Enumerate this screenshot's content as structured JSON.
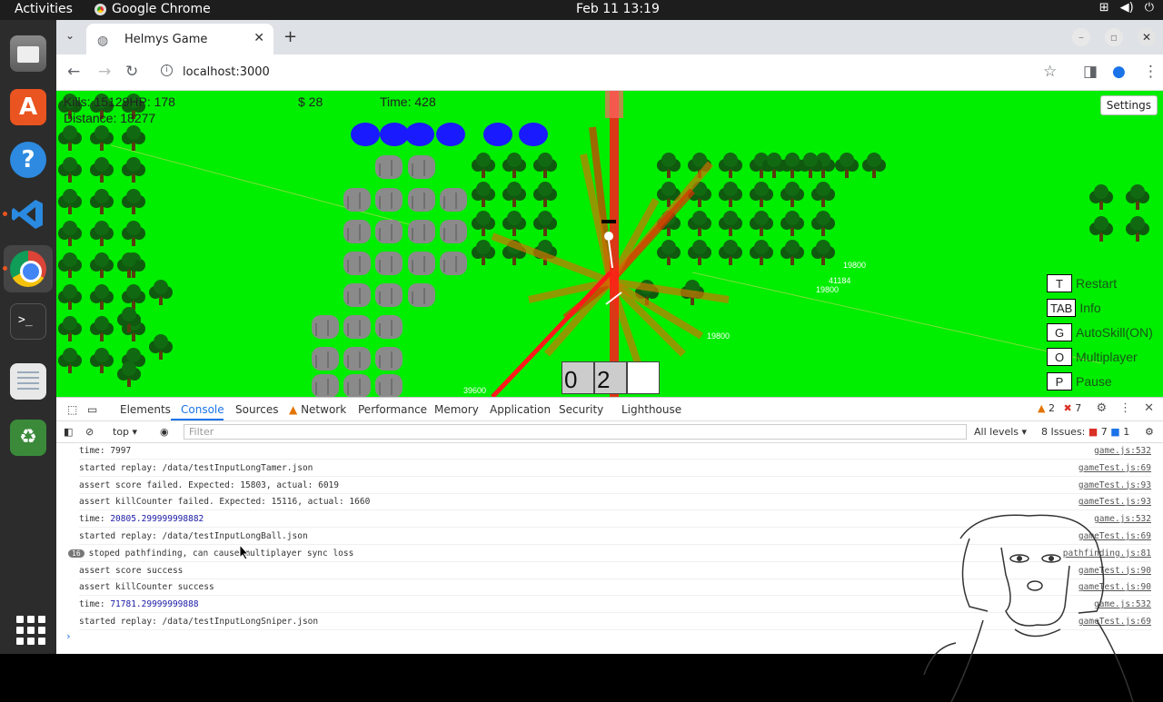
{
  "topbar": {
    "activities": "Activities",
    "app_name": "Google Chrome",
    "clock": "Feb 11  13:19"
  },
  "browser": {
    "tab_title": "Helmys Game",
    "url": "localhost:3000"
  },
  "game": {
    "hud": {
      "kills": "Kills: 15129HP: 178",
      "distance": "Distance: 18277",
      "money": "$ 28",
      "time": "Time: 428"
    },
    "settings_label": "Settings",
    "keyhints": [
      {
        "key": "T",
        "label": "Restart"
      },
      {
        "key": "TAB",
        "label": "Info"
      },
      {
        "key": "G",
        "label": "AutoSkill(ON)"
      },
      {
        "key": "O",
        "label": "Multiplayer"
      },
      {
        "key": "P",
        "label": "Pause"
      }
    ],
    "slots": [
      "0",
      "2",
      ""
    ],
    "floating_numbers": [
      "19800",
      "41184",
      "19800",
      "19800",
      "39600"
    ]
  },
  "devtools": {
    "tabs": [
      "Elements",
      "Console",
      "Sources",
      "Network",
      "Performance",
      "Memory",
      "Application",
      "Security",
      "Lighthouse"
    ],
    "active_tab": "Console",
    "warnings": "2",
    "errors": "7",
    "context": "top",
    "filter_placeholder": "Filter",
    "levels": "All levels",
    "issues": "8 Issues:",
    "issue_errors": "7",
    "issue_info": "1",
    "console_lines": [
      {
        "text": "time: 7997",
        "src": "game.js:532"
      },
      {
        "text": "started replay: /data/testInputLongTamer.json",
        "src": "gameTest.js:69"
      },
      {
        "text": "assert score failed. Expected: 15803, actual: 6019",
        "src": "gameTest.js:93"
      },
      {
        "text": "assert killCounter failed. Expected: 15116, actual: 1660",
        "src": "gameTest.js:93"
      },
      {
        "text": "time: ",
        "num": "20805.299999998882",
        "src": "game.js:532"
      },
      {
        "text": "started replay: /data/testInputLongBall.json",
        "src": "gameTest.js:69"
      },
      {
        "text": "stoped pathfinding, can cause multiplayer sync loss",
        "badge": "16",
        "src": "pathfinding.js:81"
      },
      {
        "text": "assert score success",
        "src": "gameTest.js:90"
      },
      {
        "text": "assert killCounter success",
        "src": "gameTest.js:90"
      },
      {
        "text": "time: ",
        "num": "71781.29999999888",
        "src": "game.js:532"
      },
      {
        "text": "started replay: /data/testInputLongSniper.json",
        "src": "gameTest.js:69"
      }
    ],
    "prompt": "›"
  }
}
